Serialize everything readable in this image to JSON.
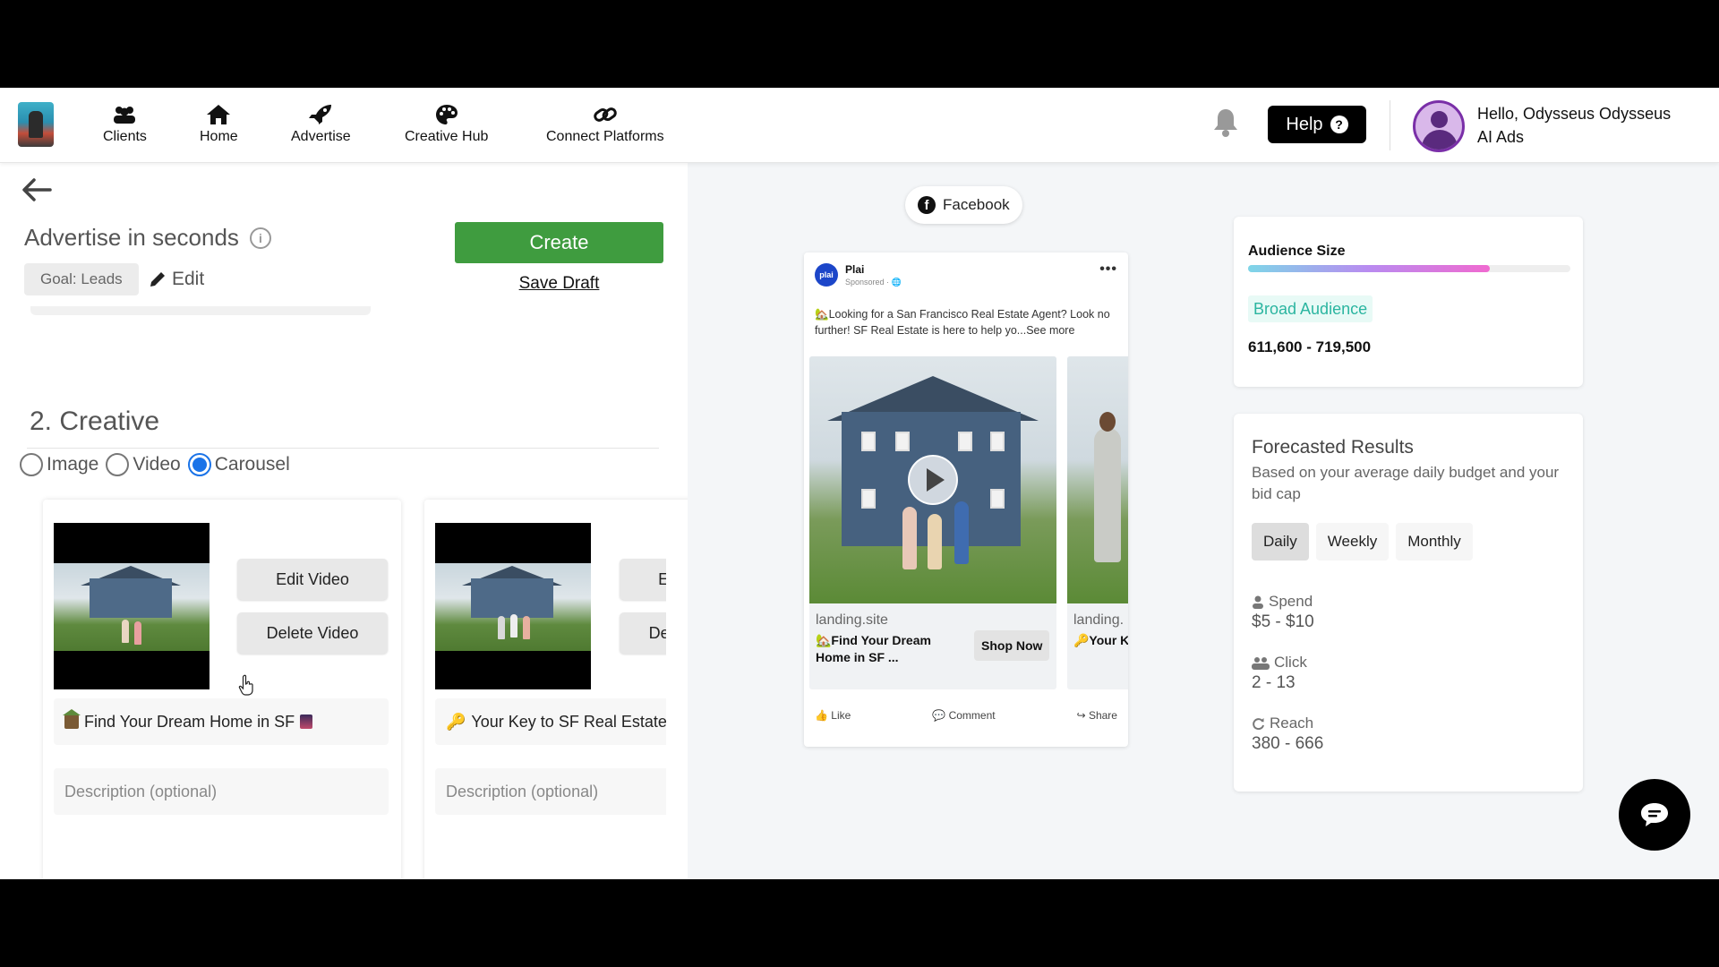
{
  "nav": {
    "items": [
      {
        "label": "Clients",
        "icon": "users-icon"
      },
      {
        "label": "Home",
        "icon": "home-icon"
      },
      {
        "label": "Advertise",
        "icon": "rocket-icon"
      },
      {
        "label": "Creative Hub",
        "icon": "palette-icon"
      },
      {
        "label": "Connect Platforms",
        "icon": "link-icon"
      }
    ],
    "help_label": "Help",
    "help_icon_glyph": "?",
    "user_greeting": "Hello, Odysseus Odysseus",
    "user_org": "AI Ads"
  },
  "editor": {
    "title": "Advertise in seconds",
    "info_glyph": "i",
    "goal_chip": "Goal: Leads",
    "edit_label": "Edit",
    "create_label": "Create",
    "save_draft_label": "Save Draft",
    "section_title": "2. Creative",
    "creative_types": [
      {
        "label": "Image",
        "checked": false
      },
      {
        "label": "Video",
        "checked": false
      },
      {
        "label": "Carousel",
        "checked": true
      }
    ],
    "cards": [
      {
        "edit_video_label": "Edit Video",
        "delete_video_label": "Delete Video",
        "headline": "Find Your Dream Home in SF",
        "description_placeholder": "Description (optional)"
      },
      {
        "edit_video_label": "Edit Video",
        "delete_video_label": "Delete Video",
        "headline": "Your Key to SF Real Estate",
        "description_placeholder": "Description (optional)"
      }
    ]
  },
  "preview": {
    "platform": "Facebook",
    "platform_glyph": "f",
    "page_name": "Plai",
    "logo_text": "plai",
    "sponsored_text": "Sponsored · 🌐",
    "more_glyph": "•••",
    "primary_text": "🏡Looking for a San Francisco Real Estate Agent? Look no further! SF Real Estate is here to help yo...See more",
    "slides": [
      {
        "domain": "landing.site",
        "headline": "🏡Find Your Dream Home in SF ...",
        "cta": "Shop Now"
      },
      {
        "domain": "landing.",
        "headline": "🔑Your Key to SF Real Estat"
      }
    ],
    "actions": {
      "like": "Like",
      "comment": "Comment",
      "share": "Share"
    }
  },
  "audience": {
    "title": "Audience Size",
    "fill_fraction": 0.75,
    "tag": "Broad Audience",
    "range": "611,600 - 719,500"
  },
  "forecast": {
    "title": "Forecasted Results",
    "subtitle": "Based on your average daily budget and your bid cap",
    "tabs": [
      {
        "label": "Daily",
        "active": true
      },
      {
        "label": "Weekly",
        "active": false
      },
      {
        "label": "Monthly",
        "active": false
      }
    ],
    "metrics": [
      {
        "label": "Spend",
        "value": "$5 - $10",
        "icon": "person-icon"
      },
      {
        "label": "Click",
        "value": "2 - 13",
        "icon": "group-icon"
      },
      {
        "label": "Reach",
        "value": "380 - 666",
        "icon": "refresh-icon"
      }
    ]
  },
  "colors": {
    "primary_green": "#3f9c3f",
    "accent_blue": "#1a73e8",
    "audience_tag": "#2bb5a0",
    "help_bg": "#000000"
  }
}
